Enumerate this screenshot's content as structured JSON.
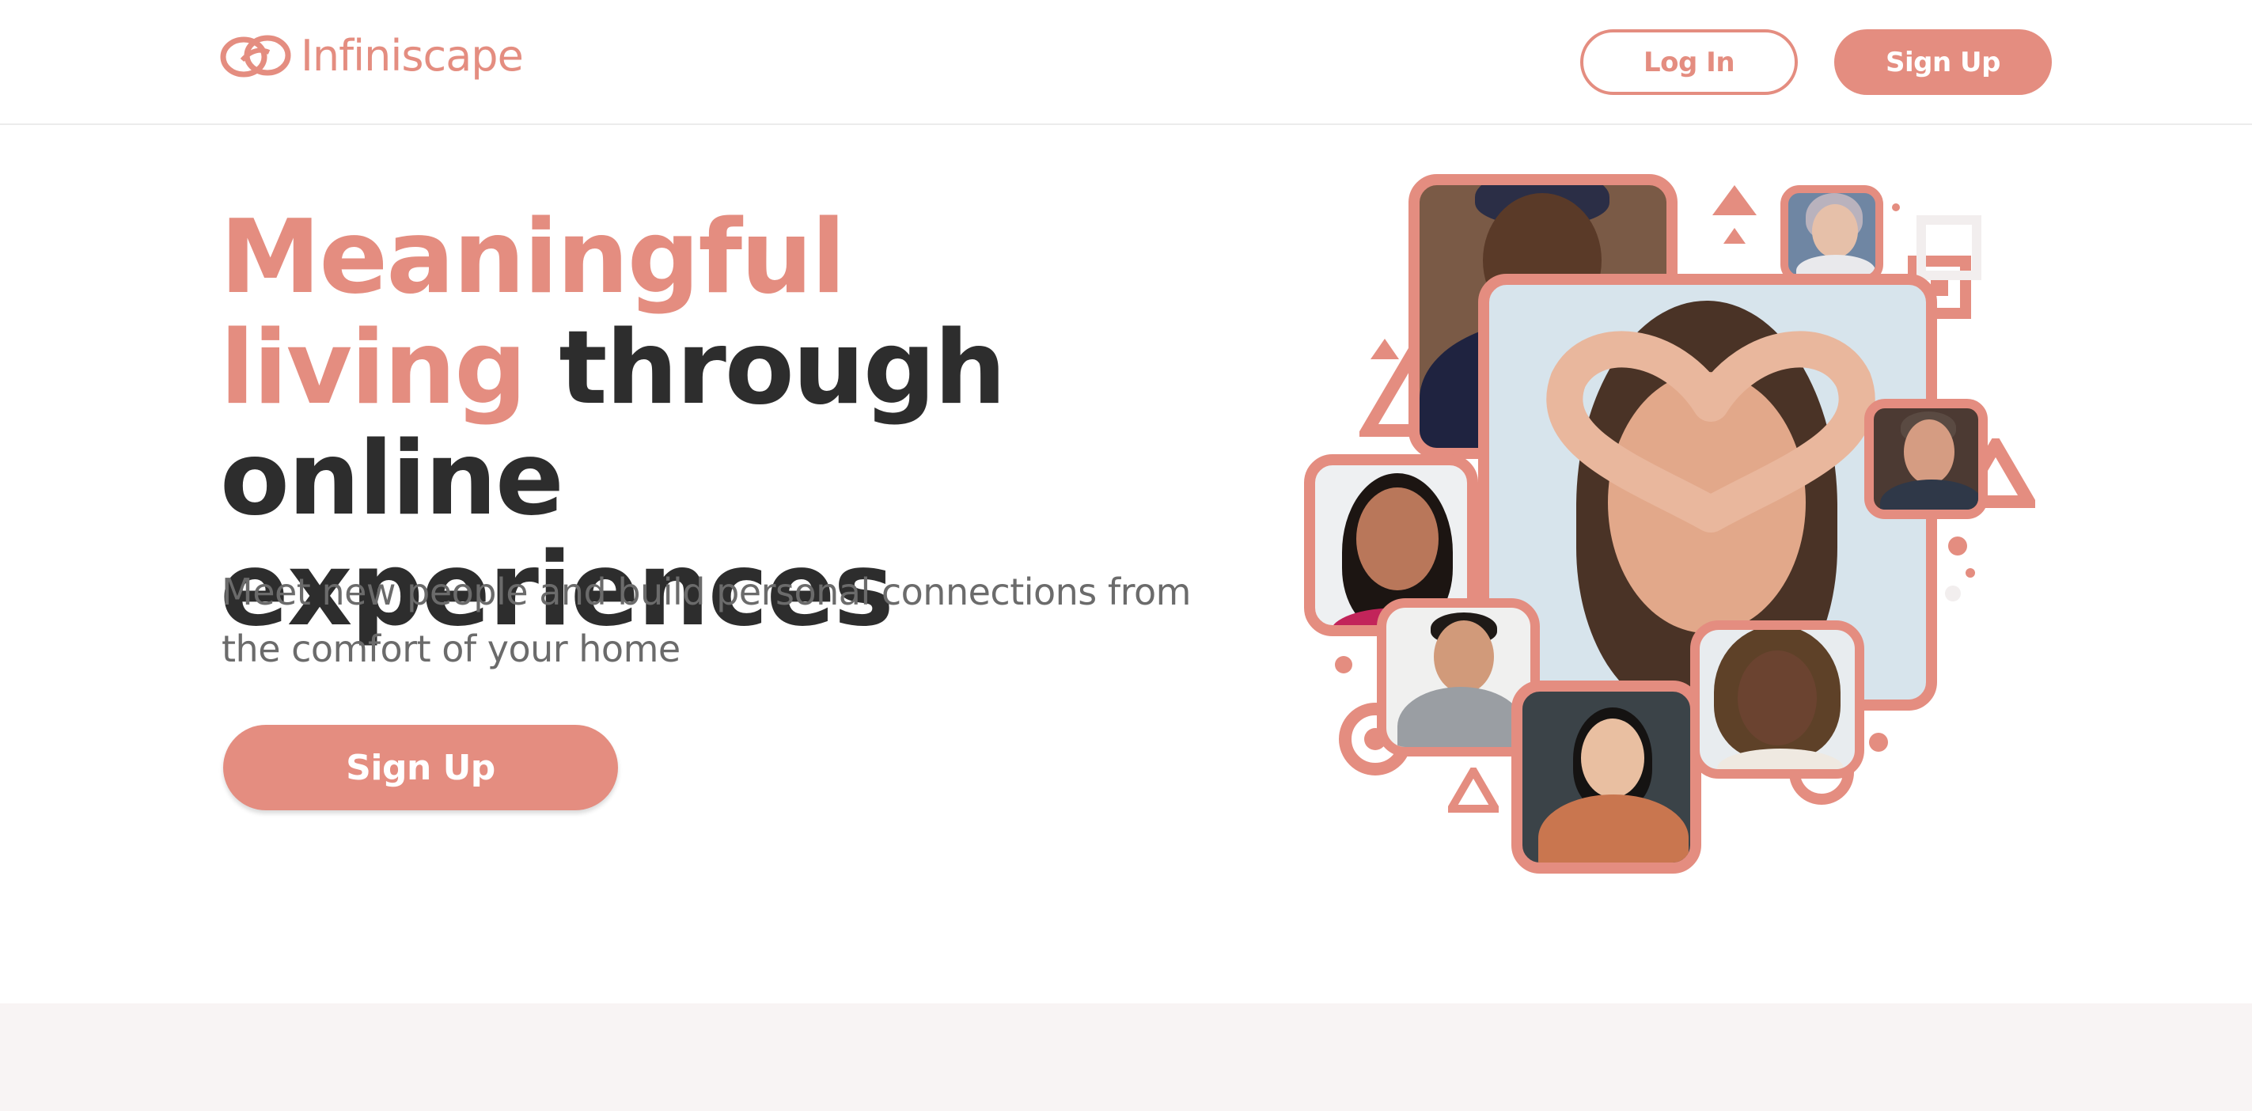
{
  "brand": {
    "name": "Infiniscape",
    "logo_icon": "infinity-rings-icon",
    "accent_color": "#e48d80"
  },
  "nav": {
    "login_label": "Log In",
    "signup_label": "Sign Up"
  },
  "hero": {
    "title_accent_1": "Meaningful",
    "title_accent_2": "living",
    "title_rest_1": "through",
    "title_rest_2": "online experiences",
    "subtitle": "Meet new people and build personal connections from the comfort of your home",
    "cta_label": "Sign Up"
  },
  "colors": {
    "text_dark": "#2d2d2d",
    "text_muted": "#6b6b6b",
    "footer_band": "#f8f4f4"
  }
}
